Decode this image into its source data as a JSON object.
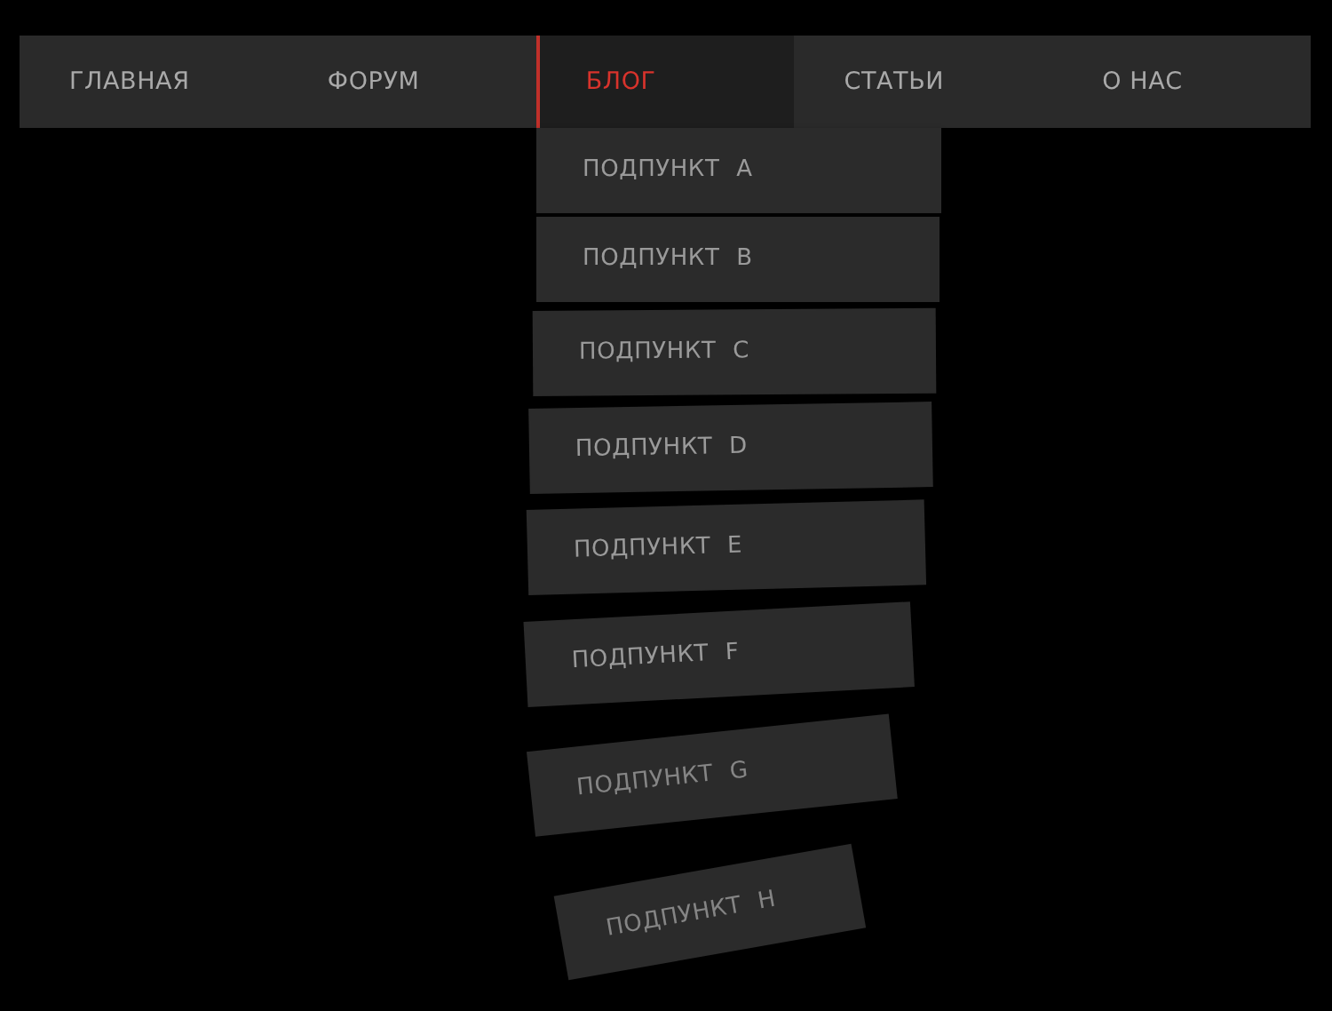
{
  "menu": [
    {
      "label": "ГЛАВНАЯ",
      "selected": false
    },
    {
      "label": "ФОРУМ",
      "selected": false
    },
    {
      "label": "БЛОГ",
      "selected": true
    },
    {
      "label": "СТАТЬИ",
      "selected": false
    },
    {
      "label": "О НАС",
      "selected": false
    }
  ],
  "submenu": [
    "ПОДПУНКТ A",
    "ПОДПУНКТ B",
    "ПОДПУНКТ C",
    "ПОДПУНКТ D",
    "ПОДПУНКТ E",
    "ПОДПУНКТ F",
    "ПОДПУНКТ G",
    "ПОДПУНКТ H"
  ]
}
